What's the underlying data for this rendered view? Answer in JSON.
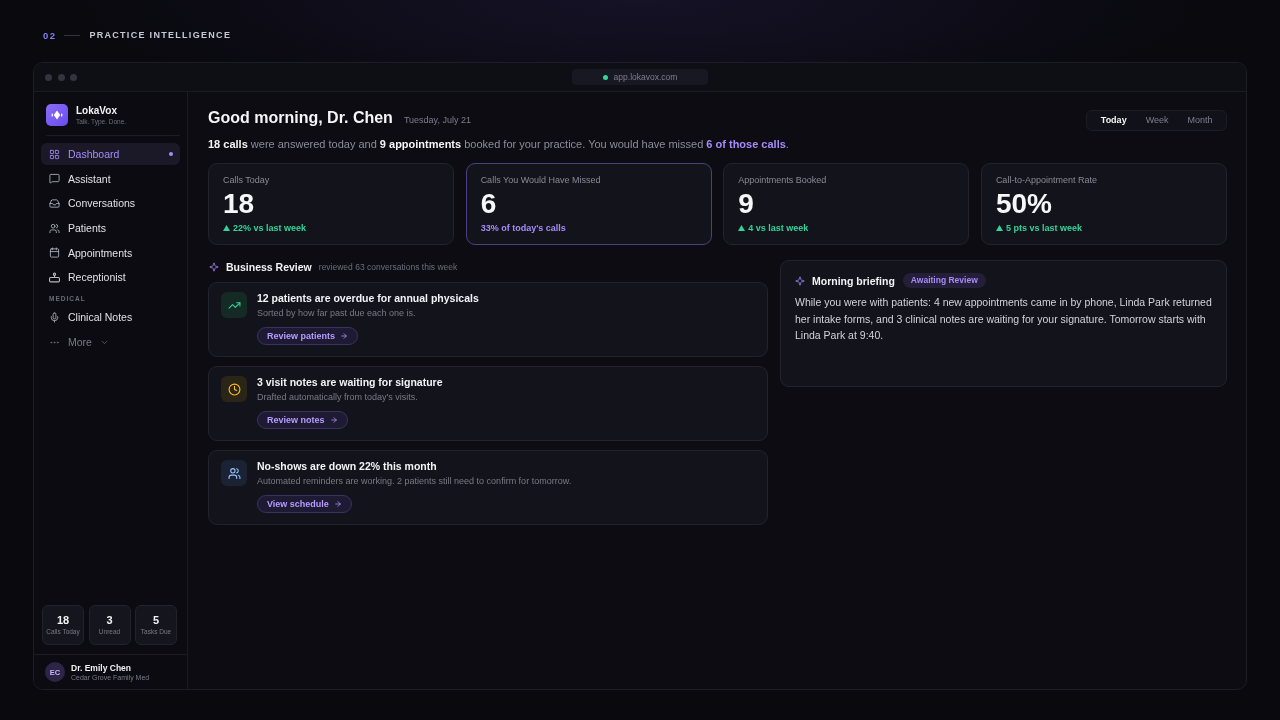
{
  "header": {
    "index": "02",
    "title": "PRACTICE INTELLIGENCE"
  },
  "browser": {
    "url": "app.lokavox.com"
  },
  "sidebar": {
    "brand": {
      "name": "LokaVox",
      "tagline": "Talk. Type. Done."
    },
    "nav": [
      {
        "label": "Dashboard",
        "selected": true
      },
      {
        "label": "Assistant",
        "selected": false
      },
      {
        "label": "Conversations",
        "selected": false
      },
      {
        "label": "Patients",
        "selected": false
      },
      {
        "label": "Appointments",
        "selected": false
      },
      {
        "label": "Receptionist",
        "selected": false
      }
    ],
    "sections": [
      {
        "title": "MEDICAL",
        "items": [
          {
            "label": "Clinical Notes",
            "selected": false
          }
        ]
      }
    ],
    "more": {
      "label": "More",
      "expanded": false
    },
    "stats": [
      {
        "value": "18",
        "label": "Calls Today"
      },
      {
        "value": "3",
        "label": "Unread"
      },
      {
        "value": "5",
        "label": "Tasks Due"
      }
    ],
    "user": {
      "initials": "EC",
      "name": "Dr. Emily Chen",
      "practice": "Cedar Grove Family Med"
    }
  },
  "main": {
    "greeting": "Good morning, Dr. Chen",
    "date": "Tuesday, July 21",
    "range_tabs": [
      {
        "label": "Today",
        "selected": true
      },
      {
        "label": "Week",
        "selected": false
      },
      {
        "label": "Month",
        "selected": false
      }
    ],
    "summary": [
      {
        "kind": "strong",
        "text": "18 calls"
      },
      {
        "kind": "plain",
        "text": " were answered today and "
      },
      {
        "kind": "strong",
        "text": "9 appointments"
      },
      {
        "kind": "plain",
        "text": " booked for your practice. You would have missed "
      },
      {
        "kind": "accent",
        "text": "6 of those calls"
      },
      {
        "kind": "plain",
        "text": "."
      }
    ],
    "stats": [
      {
        "label": "Calls Today",
        "value": "18",
        "note": "22% vs last week",
        "kind": "trend",
        "highlighted": false
      },
      {
        "label": "Calls You Would Have Missed",
        "value": "6",
        "note": "33% of today's calls",
        "kind": "share",
        "highlighted": true
      },
      {
        "label": "Appointments Booked",
        "value": "9",
        "note": "4 vs last week",
        "kind": "trend",
        "highlighted": false
      },
      {
        "label": "Call-to-Appointment Rate",
        "value": "50%",
        "note": "5 pts vs last week",
        "kind": "trend",
        "highlighted": false
      }
    ],
    "business_review": {
      "title": "Business Review",
      "subtitle": "reviewed 63 conversations this week",
      "insights": [
        {
          "kind": "growth",
          "title": "12 patients are overdue for annual physicals",
          "detail": "Sorted by how far past due each one is.",
          "action": "Review patients"
        },
        {
          "kind": "pending",
          "title": "3 visit notes are waiting for signature",
          "detail": "Drafted automatically from today's visits.",
          "action": "Review notes"
        },
        {
          "kind": "attendance",
          "title": "No-shows are down 22% this month",
          "detail": "Automated reminders are working. 2 patients still need to confirm for tomorrow.",
          "action": "View schedule"
        }
      ]
    },
    "briefing": {
      "title": "Morning briefing",
      "badge": "Awaiting Review",
      "text": "While you were with patients: 4 new appointments came in by phone, Linda Park returned her intake forms, and 3 clinical notes are waiting for your signature. Tomorrow starts with Linda Park at 9:40."
    }
  }
}
